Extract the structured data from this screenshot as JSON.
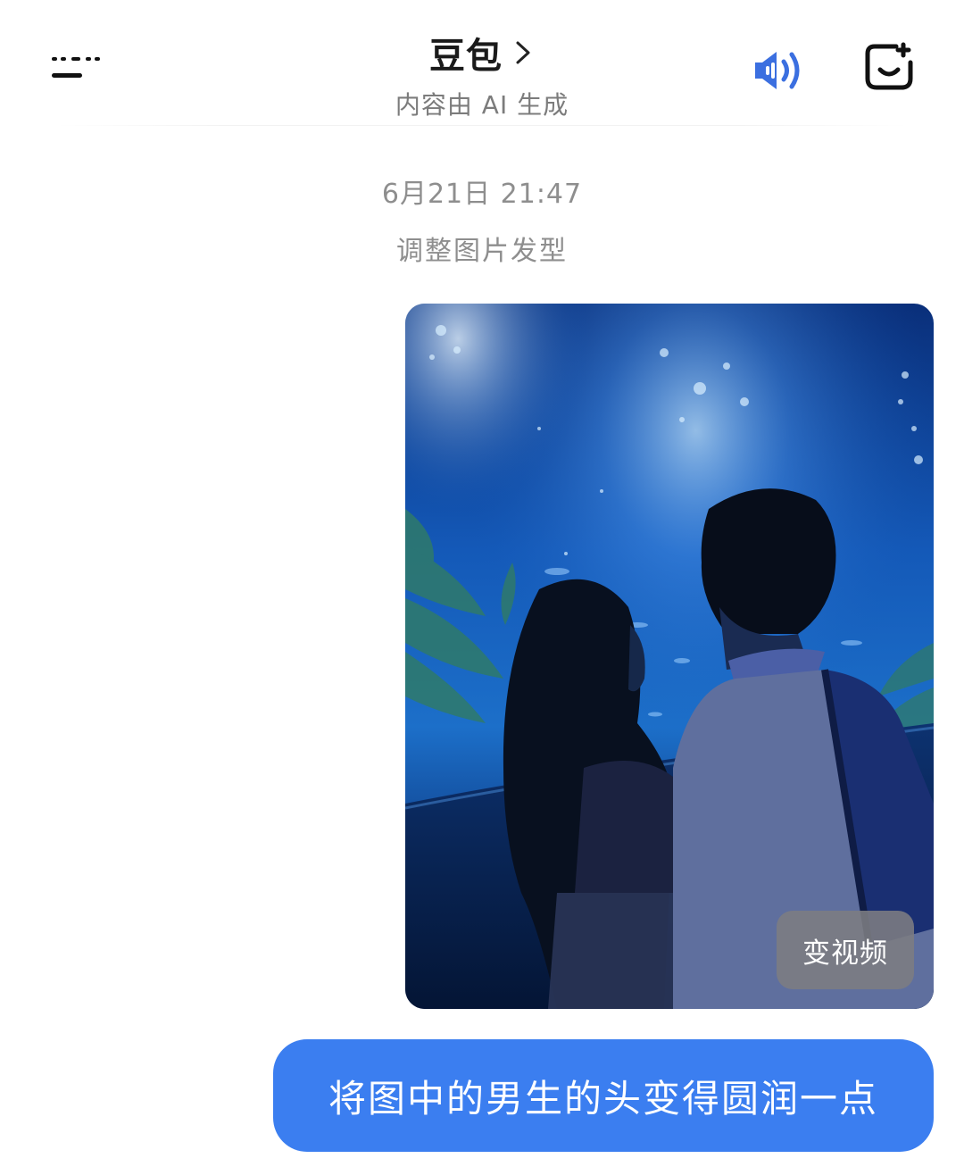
{
  "header": {
    "title": "豆包",
    "subtitle": "内容由 AI 生成",
    "icons": {
      "menu": "menu-icon",
      "chevron": "chevron-right-icon",
      "speaker": "speaker-icon",
      "new_chat": "new-chat-icon"
    },
    "accent_color": "#3b6fe0"
  },
  "chat": {
    "timestamp": "6月21日 21:47",
    "caption": "调整图片发型",
    "image_message": {
      "action_button": "变视频"
    },
    "user_message": {
      "text": "将图中的男生的头变得圆润一点",
      "bubble_color": "#3b7ef0"
    }
  }
}
